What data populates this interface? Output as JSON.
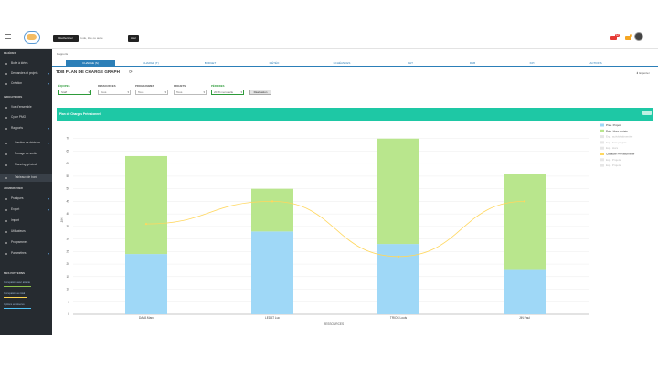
{
  "header": {
    "search_label": "Rechercher",
    "search_placeholder": "Code, titre ou autre",
    "go_label": "Aller",
    "badge1": "12",
    "badge2": "5"
  },
  "sidebar": {
    "section1": "FILIÈRES",
    "items1": [
      "Boite à idées",
      "Demandes et projets",
      "Création"
    ],
    "section2": "INDICATEURS",
    "items2": [
      "Vue d'ensemble",
      "Cycle PMO",
      "Rapports",
      "Gestion de décision",
      "Rouage de sortie",
      "Planning général",
      "Tableaux de bord"
    ],
    "section3": "ADMINISTRER",
    "items3": [
      "Pratiques",
      "Export",
      "Import",
      "Utilisateurs",
      "Programmes",
      "Paramètres"
    ],
    "section4": "MES PATTERNS",
    "notes": [
      "Occupation avec attente",
      "Occupation au total",
      "Options en réserve"
    ]
  },
  "main": {
    "breadcrumb": "Rapports",
    "tabs": [
      "CHARGE (S)",
      "CHARGE (T)",
      "BUDGET",
      "MÉTÉO",
      "ÉCHÉANCES",
      "FHT",
      "RAB",
      "KPI",
      "ACTIONS"
    ],
    "title": "TDB PLAN DE CHARGE GRAPH",
    "export": "Exporter",
    "filters": [
      {
        "label": "ÉQUIPES",
        "value": "Staff",
        "color": "#2e9b3a"
      },
      {
        "label": "RESSOURCES",
        "value": "Tous",
        "color": "#555"
      },
      {
        "label": "PROGRAMMES",
        "value": "Tous",
        "color": "#555"
      },
      {
        "label": "PROJETS",
        "value": "Tous",
        "color": "#555"
      },
      {
        "label": "PÉRIODES",
        "value": "2018 mensuelle",
        "color": "#2e9b3a"
      }
    ],
    "validate": "Réalisation",
    "panel_title": "Plan de Charges Prévisionnel"
  },
  "chart_data": {
    "type": "bar",
    "categories": [
      "DAVA Marc",
      "LEDAT Luc",
      "TRIOS Louis",
      "JIN Paul"
    ],
    "series": [
      {
        "name": "Prév. Projets",
        "values": [
          24,
          33,
          28,
          18
        ],
        "color": "#9fd8f7"
      },
      {
        "name": "Prév. Hors projets",
        "values": [
          39,
          17,
          42,
          38
        ],
        "color": "#b9e68d"
      },
      {
        "name": "Capacité Prévisionnelle",
        "values": [
          36,
          45,
          23,
          45
        ],
        "color": "#ffd75e",
        "type": "line"
      }
    ],
    "legend_extra": [
      "Exp. activité absentée",
      "Exp. hors projets",
      "Exp. Hors",
      "Exp. Projets",
      "Exp. Projets"
    ],
    "xlabel": "RESSOURCES",
    "ylabel": "J/H",
    "ylim": [
      0,
      75
    ],
    "yticks": [
      0,
      5,
      10,
      15,
      20,
      25,
      30,
      35,
      40,
      45,
      50,
      55,
      60,
      65,
      70
    ],
    "grid": true,
    "legend_position": "right"
  }
}
